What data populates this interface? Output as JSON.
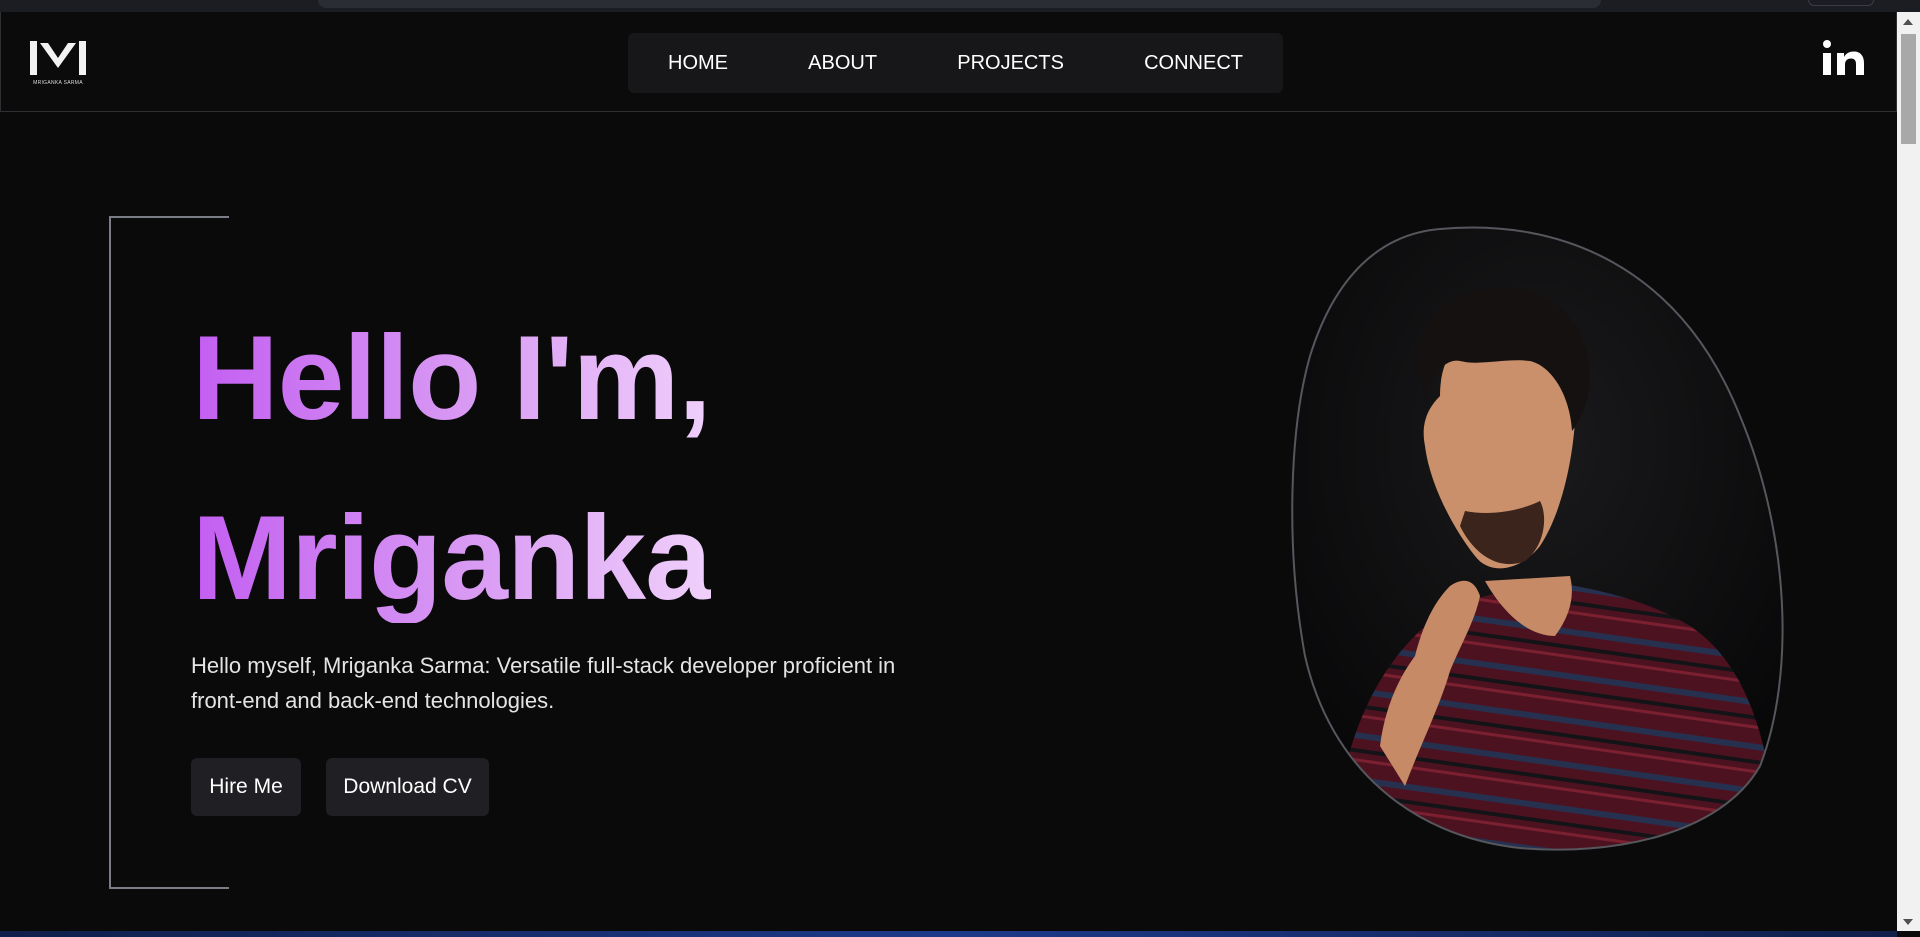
{
  "header": {
    "logo": {
      "text": "MRIGANKA SARMA",
      "icon": "m-monogram-logo"
    },
    "nav": [
      {
        "label": "HOME"
      },
      {
        "label": "ABOUT"
      },
      {
        "label": "PROJECTS"
      },
      {
        "label": "CONNECT"
      }
    ],
    "social_icon": "linkedin-icon"
  },
  "hero": {
    "greeting": "Hello I'm,",
    "name": "Mriganka",
    "intro": "Hello myself, Mriganka Sarma: Versatile full-stack developer proficient in front-end and back-end technologies.",
    "buttons": {
      "hire": "Hire Me",
      "cv": "Download CV"
    },
    "portrait_alt": "Portrait of Mriganka Sarma"
  },
  "colors": {
    "background": "#0a0a0b",
    "heading_gradient_start": "#c35ef2",
    "heading_gradient_end": "#f0d0fb",
    "button_bg": "#1f1f24",
    "nav_bg": "#171719"
  }
}
